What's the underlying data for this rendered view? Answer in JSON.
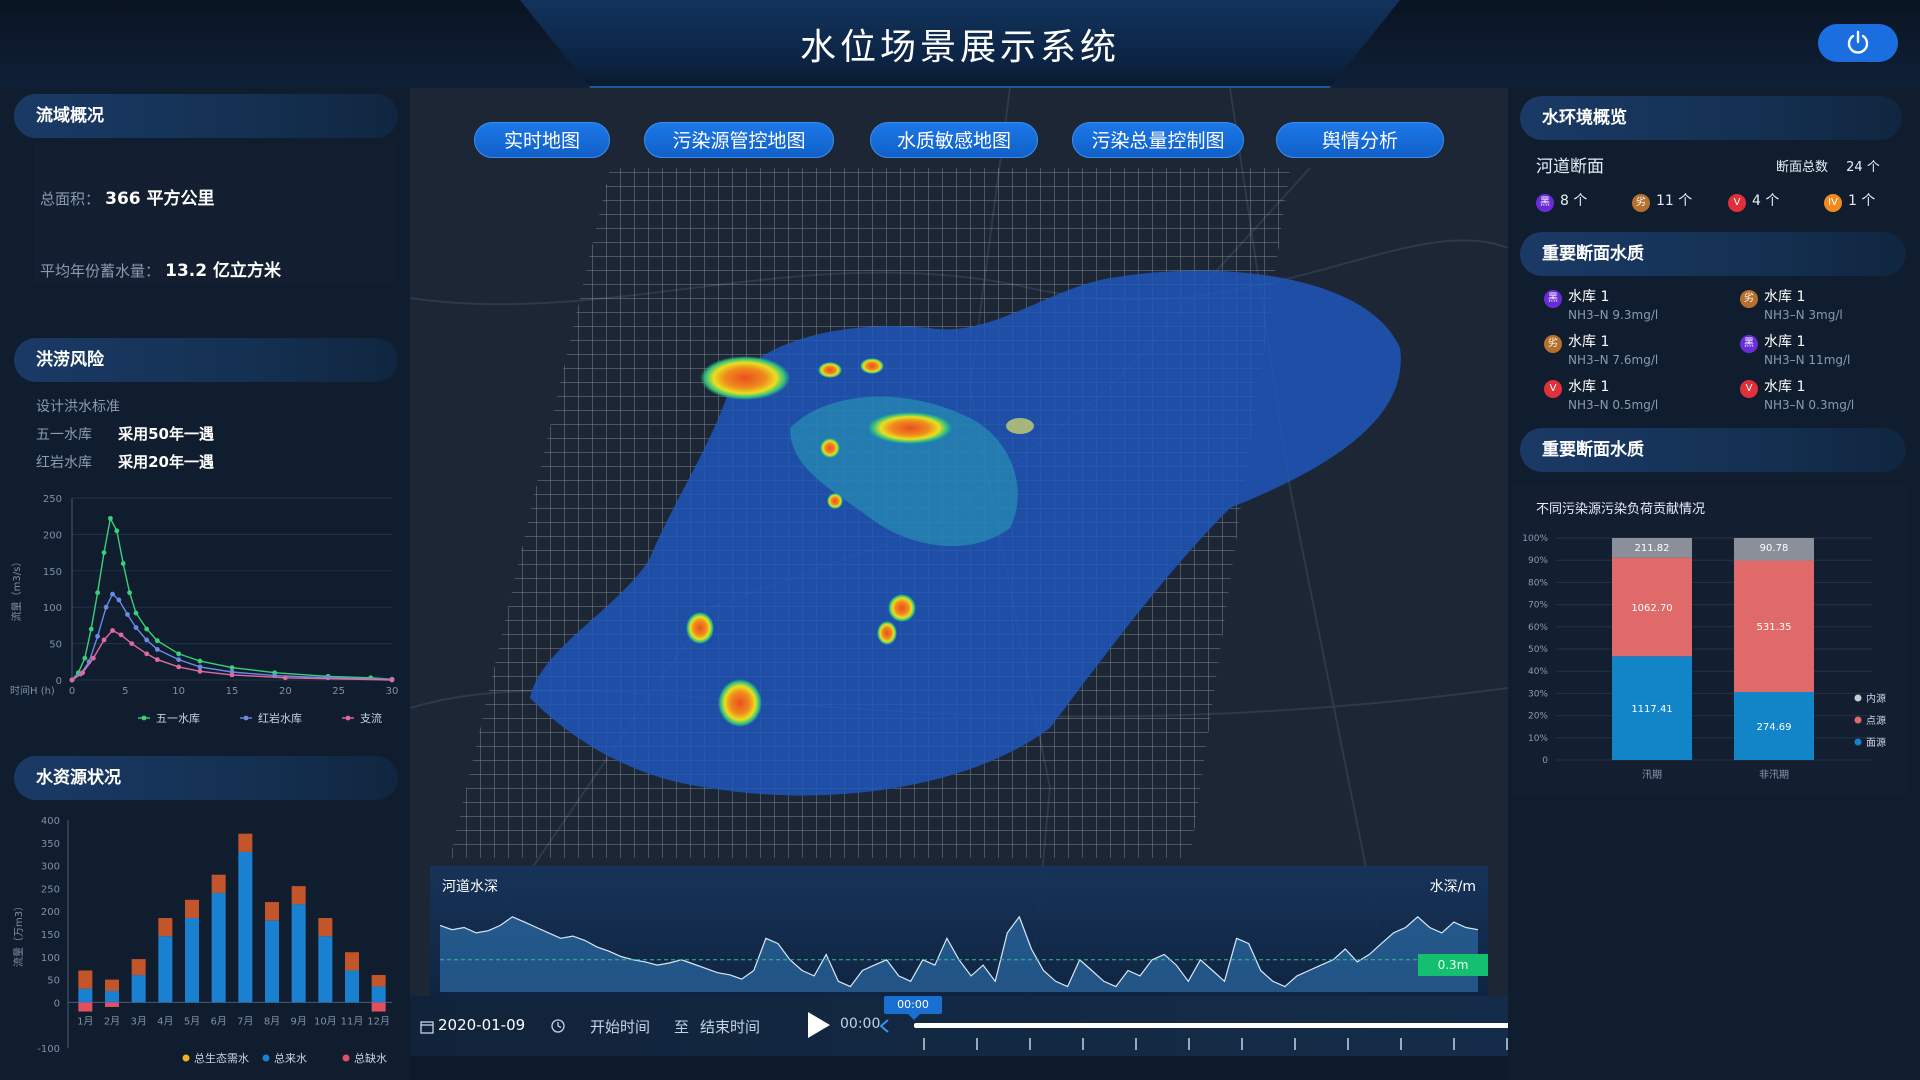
{
  "header": {
    "title": "水位场景展示系统"
  },
  "left": {
    "basin": {
      "title": "流域概况",
      "area_label": "总面积：",
      "area_value": "366 平方公里",
      "storage_label": "平均年份蓄水量：",
      "storage_value": "13.2 亿立方米"
    },
    "flood": {
      "title": "洪涝风险",
      "standard_label": "设计洪水标准",
      "rows": [
        {
          "name": "五一水库",
          "value": "采用50年一遇"
        },
        {
          "name": "红岩水库",
          "value": "采用20年一遇"
        }
      ]
    },
    "water_resources": {
      "title": "水资源状况"
    }
  },
  "tabs": [
    "实时地图",
    "污染源管控地图",
    "水质敏感地图",
    "污染总量控制图",
    "舆情分析"
  ],
  "depth": {
    "title": "河道水深",
    "unit": "水深/m",
    "threshold": "0.3m"
  },
  "timeline": {
    "date": "2020-01-09",
    "start": "开始时间",
    "to": "至",
    "end": "结束时间",
    "current": "00:00",
    "marker": "00:00"
  },
  "right": {
    "overview": {
      "title": "水环境概览",
      "subtitle": "河道断面",
      "total_label": "断面总数",
      "total_value": "24 个",
      "grades": [
        {
          "badge": "黑",
          "count": "8 个",
          "color": "#6a2cd8"
        },
        {
          "badge": "劣",
          "count": "11 个",
          "color": "#b5702e"
        },
        {
          "badge": "V",
          "count": "4 个",
          "color": "#e0303a"
        },
        {
          "badge": "IV",
          "count": "1 个",
          "color": "#f08a1e"
        }
      ]
    },
    "important": {
      "title": "重要断面水质",
      "items": [
        {
          "badge": "黑",
          "color": "#6a2cd8",
          "name": "水库 1",
          "value": "NH3–N 9.3mg/l"
        },
        {
          "badge": "劣",
          "color": "#b5702e",
          "name": "水库 1",
          "value": "NH3–N 3mg/l"
        },
        {
          "badge": "劣",
          "color": "#b5702e",
          "name": "水库 1",
          "value": "NH3–N 7.6mg/l"
        },
        {
          "badge": "黑",
          "color": "#6a2cd8",
          "name": "水库 1",
          "value": "NH3–N 11mg/l"
        },
        {
          "badge": "V",
          "color": "#e0303a",
          "name": "水库 1",
          "value": "NH3–N 0.5mg/l"
        },
        {
          "badge": "V",
          "color": "#e0303a",
          "name": "水库 1",
          "value": "NH3–N 0.3mg/l"
        }
      ]
    },
    "contribution": {
      "title": "重要断面水质",
      "subtitle": "不同污染源污染负荷贡献情况"
    }
  },
  "chart_data": [
    {
      "id": "flood_hydrograph",
      "type": "line",
      "ylabel": "流量（m3/s）",
      "xlabel": "时间H (h)",
      "ylim": [
        0,
        250
      ],
      "yticks": [
        0,
        50,
        100,
        150,
        200,
        250
      ],
      "xlim": [
        0,
        30
      ],
      "xticks": [
        0,
        5,
        10,
        15,
        20,
        25,
        30
      ],
      "legend_position": "bottom",
      "series": [
        {
          "name": "五一水库",
          "color": "#3ad07a",
          "x": [
            0,
            0.6,
            1.2,
            1.8,
            2.4,
            3,
            3.6,
            4.2,
            4.8,
            5.4,
            6,
            7,
            8,
            10,
            12,
            15,
            19,
            24,
            28,
            30
          ],
          "y": [
            0,
            10,
            30,
            70,
            120,
            175,
            222,
            205,
            160,
            120,
            92,
            70,
            54,
            36,
            26,
            17,
            10,
            5,
            3,
            1
          ]
        },
        {
          "name": "红岩水库",
          "color": "#6a8ae8",
          "x": [
            0,
            0.8,
            1.6,
            2.4,
            3.2,
            3.8,
            4.4,
            5.2,
            6,
            7,
            8,
            10,
            12,
            15,
            19,
            24,
            30
          ],
          "y": [
            0,
            8,
            25,
            60,
            100,
            118,
            110,
            90,
            72,
            55,
            42,
            28,
            18,
            11,
            6,
            3,
            1
          ]
        },
        {
          "name": "支流",
          "color": "#e06aa0",
          "x": [
            0,
            1,
            2,
            3,
            3.8,
            4.6,
            5.6,
            7,
            8,
            10,
            12,
            15,
            20,
            30
          ],
          "y": [
            0,
            10,
            30,
            55,
            68,
            62,
            50,
            36,
            28,
            18,
            12,
            7,
            3,
            0
          ]
        }
      ]
    },
    {
      "id": "water_resources",
      "type": "bar",
      "ylabel": "流量（万m3）",
      "ylim": [
        -100,
        400
      ],
      "yticks": [
        -100,
        0,
        50,
        100,
        150,
        200,
        250,
        300,
        350,
        400
      ],
      "categories": [
        "1月",
        "2月",
        "3月",
        "4月",
        "5月",
        "6月",
        "7月",
        "8月",
        "9月",
        "10月",
        "11月",
        "12月"
      ],
      "legend_position": "bottom",
      "series": [
        {
          "name": "总生态需水",
          "color": "#f0b020",
          "values": [
            0,
            0,
            0,
            0,
            0,
            0,
            0,
            0,
            0,
            0,
            0,
            0
          ]
        },
        {
          "name": "总来水",
          "color": "#1a80d0",
          "values": [
            30,
            25,
            60,
            145,
            185,
            240,
            330,
            180,
            215,
            145,
            70,
            35
          ]
        },
        {
          "name": "总缺水",
          "color": "#e05060",
          "values": [
            -20,
            -10,
            0,
            0,
            0,
            0,
            0,
            0,
            0,
            0,
            0,
            -20
          ]
        }
      ],
      "extra_top": {
        "color": "#c2552a",
        "values": [
          40,
          25,
          35,
          40,
          40,
          40,
          40,
          40,
          40,
          40,
          40,
          25
        ]
      }
    },
    {
      "id": "depth_series",
      "type": "area",
      "series": [
        {
          "name": "河道水深",
          "values": [
            0.62,
            0.58,
            0.6,
            0.55,
            0.57,
            0.62,
            0.7,
            0.65,
            0.6,
            0.55,
            0.5,
            0.52,
            0.48,
            0.42,
            0.38,
            0.33,
            0.3,
            0.28,
            0.25,
            0.27,
            0.3,
            0.26,
            0.22,
            0.18,
            0.16,
            0.12,
            0.2,
            0.5,
            0.45,
            0.3,
            0.2,
            0.15,
            0.35,
            0.1,
            0.05,
            0.2,
            0.25,
            0.3,
            0.15,
            0.1,
            0.3,
            0.25,
            0.5,
            0.3,
            0.15,
            0.25,
            0.1,
            0.55,
            0.7,
            0.4,
            0.2,
            0.1,
            0.05,
            0.3,
            0.2,
            0.1,
            0.05,
            0.2,
            0.15,
            0.3,
            0.35,
            0.25,
            0.1,
            0.3,
            0.2,
            0.1,
            0.5,
            0.45,
            0.2,
            0.1,
            0.05,
            0.15,
            0.2,
            0.25,
            0.3,
            0.4,
            0.28,
            0.35,
            0.45,
            0.55,
            0.6,
            0.7,
            0.6,
            0.55,
            0.65,
            0.6,
            0.58
          ]
        }
      ]
    },
    {
      "id": "pollution_contribution",
      "type": "bar",
      "stacked": true,
      "percent": true,
      "yticks": [
        "0",
        "10%",
        "20%",
        "30%",
        "40%",
        "50%",
        "60%",
        "70%",
        "80%",
        "90%",
        "100%"
      ],
      "categories": [
        "汛期",
        "非汛期"
      ],
      "legend_position": "right",
      "series": [
        {
          "name": "内源",
          "color": "#8a8f9a",
          "values": [
            211.82,
            90.78
          ]
        },
        {
          "name": "点源",
          "color": "#e06a6a",
          "values": [
            1062.7,
            531.35
          ]
        },
        {
          "name": "面源",
          "color": "#1284c8",
          "values": [
            1117.41,
            274.69
          ]
        }
      ]
    }
  ]
}
